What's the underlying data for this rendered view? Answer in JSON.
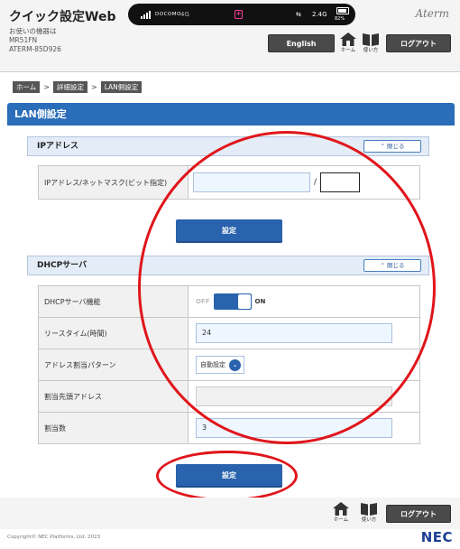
{
  "header": {
    "title": "クイック設定Web",
    "device_caption": "お使いの機器は",
    "device_model": "MR51FN",
    "device_ssid": "ATERM-85D926",
    "brand": "Aterm",
    "english_label": "English",
    "home_label": "ホーム",
    "help_label": "使い方",
    "logout_label": "ログアウト"
  },
  "status_bar": {
    "carrier": "DOCOMO",
    "network": "4G",
    "wifi_band": "2.4G",
    "battery": "82%"
  },
  "breadcrumb": [
    "ホーム",
    "詳細設定",
    "LAN側設定"
  ],
  "breadcrumb_sep": ">",
  "page_title": "LAN側設定",
  "ip_section": {
    "title": "IPアドレス",
    "collapse_label": "閉じる",
    "field_label": "IPアドレス/ネットマスク(ビット指定)",
    "ip_value": "",
    "slash": "/",
    "mask_value": "",
    "submit_label": "設定"
  },
  "dhcp_section": {
    "title": "DHCPサーバ",
    "collapse_label": "閉じる",
    "rows": {
      "function_label": "DHCPサーバ機能",
      "toggle_off": "OFF",
      "toggle_on": "ON",
      "lease_label": "リースタイム(時間)",
      "lease_value": "24",
      "pattern_label": "アドレス割当パターン",
      "pattern_value": "自動設定",
      "start_label": "割当先頭アドレス",
      "start_value": "",
      "count_label": "割当数",
      "count_value": "3"
    },
    "submit_label": "設定"
  },
  "footer": {
    "copyright": "Copyright© NEC Platforms, Ltd. 2023",
    "logo": "NEC"
  },
  "colors": {
    "accent_blue": "#2a63ad",
    "annotation_red": "#e0151b"
  }
}
